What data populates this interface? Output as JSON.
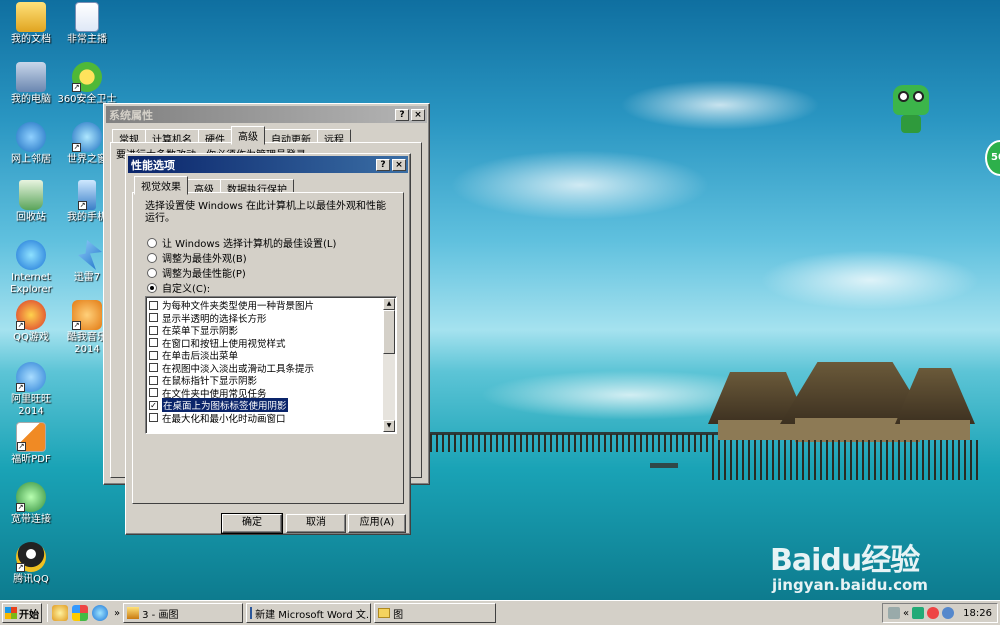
{
  "desktop": {
    "icons_left": [
      {
        "label": "我的文档",
        "icon": "my-documents-icon"
      },
      {
        "label": "我的电脑",
        "icon": "my-computer-icon"
      },
      {
        "label": "网上邻居",
        "icon": "network-icon"
      },
      {
        "label": "回收站",
        "icon": "recycle-bin-icon"
      },
      {
        "label": "Internet Explorer",
        "icon": "ie-icon"
      },
      {
        "label": "QQ游戏",
        "icon": "qq-game-icon"
      },
      {
        "label": "阿里旺旺 2014",
        "icon": "aliwangwang-icon"
      },
      {
        "label": "福昕PDF",
        "icon": "foxit-pdf-icon"
      },
      {
        "label": "宽带连接",
        "icon": "broadband-icon"
      },
      {
        "label": "腾讯QQ",
        "icon": "tencent-qq-icon"
      }
    ],
    "icons_right": [
      {
        "label": "非常主播",
        "icon": "word-doc-icon"
      },
      {
        "label": "360安全卫士",
        "icon": "360-safe-icon"
      },
      {
        "label": "世界之窗",
        "icon": "theworld-browser-icon"
      },
      {
        "label": "我的手机",
        "icon": "my-phone-icon"
      },
      {
        "label": "迅雷7",
        "icon": "thunder-icon"
      },
      {
        "label": "酷我音乐 2014",
        "icon": "kuwo-music-icon"
      }
    ],
    "widget_bubble": "50",
    "watermark": {
      "logo": "Baidu经验",
      "url": "jingyan.baidu.com"
    }
  },
  "system_properties": {
    "title": "系统属性",
    "title_buttons": [
      "?",
      "×"
    ],
    "tabs": [
      "常规",
      "计算机名",
      "硬件",
      "高级",
      "自动更新",
      "远程"
    ],
    "selected_tab": "高级",
    "partial_text": "要进行大多数改动，你必须作为管理员登录。"
  },
  "performance_options": {
    "title": "性能选项",
    "title_buttons": [
      "?",
      "×"
    ],
    "tabs": [
      "视觉效果",
      "高级",
      "数据执行保护"
    ],
    "selected_tab": "视觉效果",
    "description": "选择设置使 Windows 在此计算机上以最佳外观和性能运行。",
    "radios": [
      {
        "label": "让 Windows 选择计算机的最佳设置(L)",
        "checked": false
      },
      {
        "label": "调整为最佳外观(B)",
        "checked": false
      },
      {
        "label": "调整为最佳性能(P)",
        "checked": false
      },
      {
        "label": "自定义(C):",
        "checked": true
      }
    ],
    "effects": [
      {
        "label": "为每种文件夹类型使用一种背景图片",
        "checked": false,
        "selected": false
      },
      {
        "label": "显示半透明的选择长方形",
        "checked": false,
        "selected": false
      },
      {
        "label": "在菜单下显示阴影",
        "checked": false,
        "selected": false
      },
      {
        "label": "在窗口和按钮上使用视觉样式",
        "checked": false,
        "selected": false
      },
      {
        "label": "在单击后淡出菜单",
        "checked": false,
        "selected": false
      },
      {
        "label": "在视图中淡入淡出或滑动工具条提示",
        "checked": false,
        "selected": false
      },
      {
        "label": "在鼠标指针下显示阴影",
        "checked": false,
        "selected": false
      },
      {
        "label": "在文件夹中使用常见任务",
        "checked": false,
        "selected": false
      },
      {
        "label": "在桌面上为图标标签使用阴影",
        "checked": true,
        "selected": true
      },
      {
        "label": "在最大化和最小化时动画窗口",
        "checked": false,
        "selected": false
      }
    ],
    "buttons": {
      "ok": "确定",
      "cancel": "取消",
      "apply": "应用(A)"
    }
  },
  "taskbar": {
    "start_label": "开始",
    "quick_launch": [
      "show-desktop-icon",
      "media-icon",
      "ie-quick-icon",
      "arrows-icon"
    ],
    "tasks": [
      {
        "label": "3 - 画图",
        "icon": "paint-icon"
      },
      {
        "label": "新建 Microsoft Word 文...",
        "icon": "word-task-icon"
      },
      {
        "label": "图",
        "icon": "folder-icon"
      }
    ],
    "clock": "18:26"
  }
}
